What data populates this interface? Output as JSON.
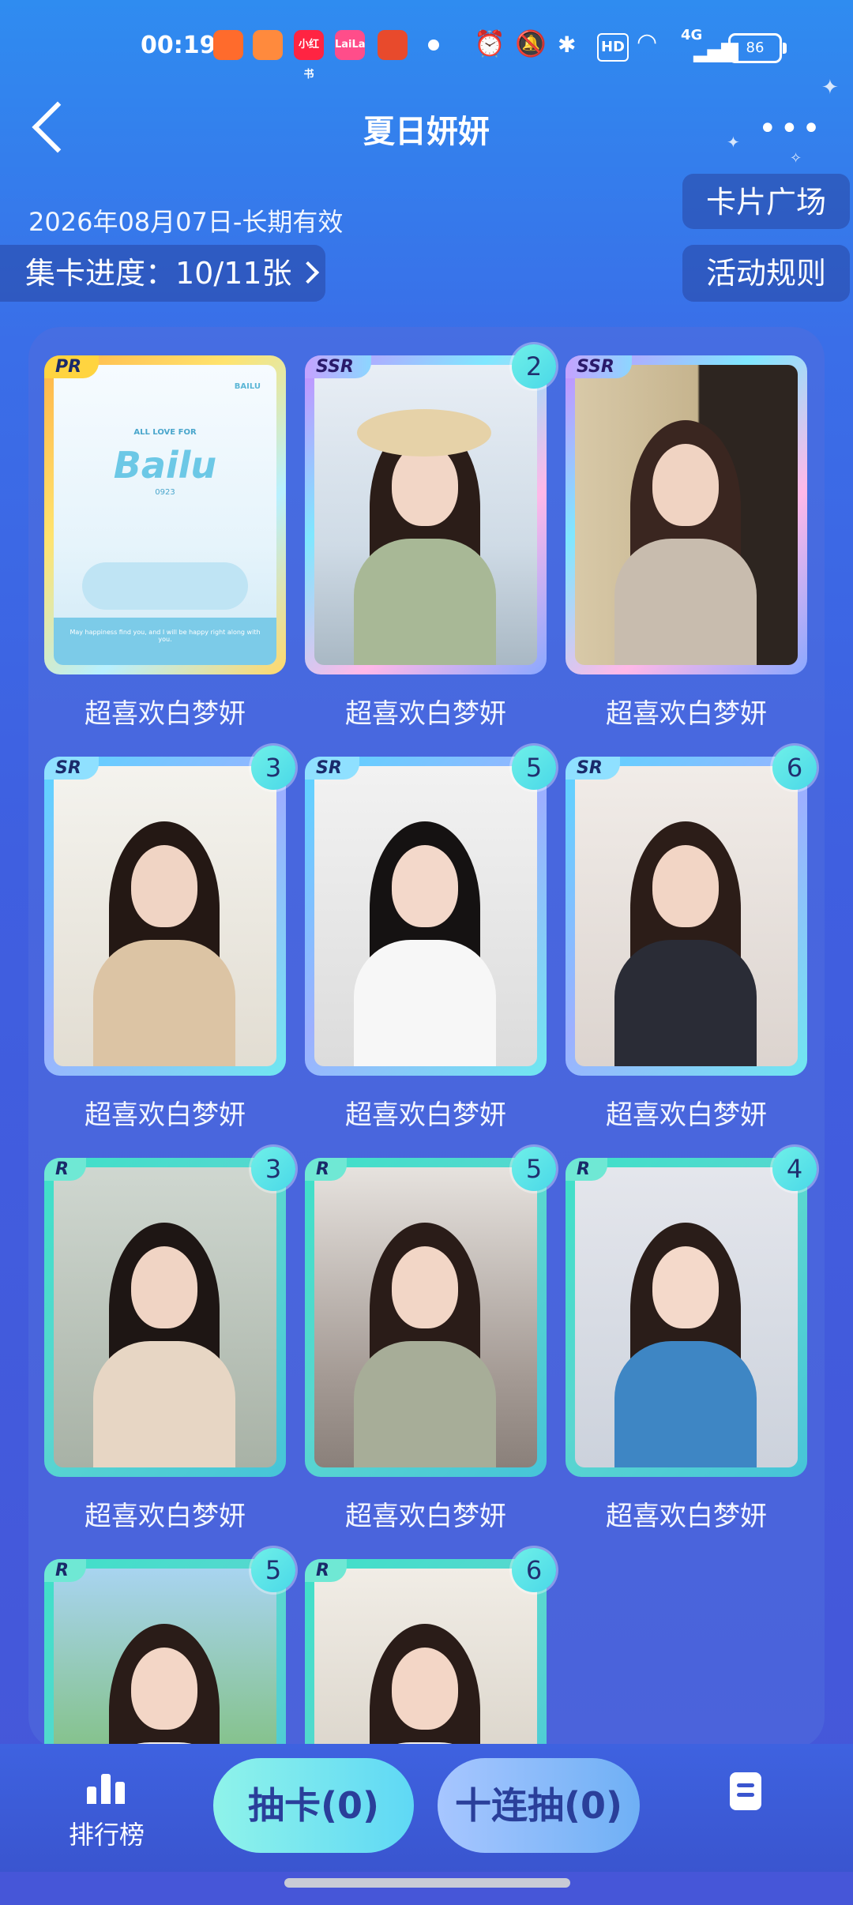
{
  "status_bar": {
    "time": "00:19",
    "apps": [
      {
        "icon": "kuaishou-icon",
        "label": "",
        "color": "#ff6b2c"
      },
      {
        "icon": "heart-app-icon",
        "label": "",
        "color": "#ff8a3d"
      },
      {
        "icon": "xiaohongshu-icon",
        "label": "小红书",
        "color": "#ff2442"
      },
      {
        "icon": "laila-icon",
        "label": "LaiLa",
        "color": "#ff4d8a"
      },
      {
        "icon": "shop-icon",
        "label": "",
        "color": "#e84a2c"
      }
    ],
    "hd": "HD",
    "network": "4G",
    "battery": "86"
  },
  "header": {
    "title": "夏日妍妍"
  },
  "validity": "2026年08月07日-长期有效",
  "progress_label": "集卡进度：10/11张",
  "plaza_button": "卡片广场",
  "rules_button": "活动规则",
  "cards": [
    {
      "rarity": "PR",
      "name": "超喜欢白梦妍",
      "count": "",
      "frame": "pr"
    },
    {
      "rarity": "SSR",
      "name": "超喜欢白梦妍",
      "count": "2",
      "frame": "ssr"
    },
    {
      "rarity": "SSR",
      "name": "超喜欢白梦妍",
      "count": "",
      "frame": "ssr"
    },
    {
      "rarity": "SR",
      "name": "超喜欢白梦妍",
      "count": "3",
      "frame": "sr"
    },
    {
      "rarity": "SR",
      "name": "超喜欢白梦妍",
      "count": "5",
      "frame": "sr"
    },
    {
      "rarity": "SR",
      "name": "超喜欢白梦妍",
      "count": "6",
      "frame": "sr"
    },
    {
      "rarity": "R",
      "name": "超喜欢白梦妍",
      "count": "3",
      "frame": "r"
    },
    {
      "rarity": "R",
      "name": "超喜欢白梦妍",
      "count": "5",
      "frame": "r"
    },
    {
      "rarity": "R",
      "name": "超喜欢白梦妍",
      "count": "4",
      "frame": "r"
    },
    {
      "rarity": "R",
      "name": "",
      "count": "5",
      "frame": "r"
    },
    {
      "rarity": "R",
      "name": "",
      "count": "6",
      "frame": "r"
    }
  ],
  "pr_card_art": {
    "top_left": "PR",
    "top_right": "BAILU",
    "tagline": "ALL LOVE FOR",
    "logo": "Bailu",
    "sub": "0923",
    "footer": "May happiness find you, and I will be happy right along with you."
  },
  "bottom_nav": {
    "rank_label": "排行榜",
    "draw_one": "抽卡(0)",
    "draw_ten": "十连抽(0)",
    "ticker": ""
  },
  "colors": {
    "bg_top": "#2f8cf0",
    "bg_bottom": "#4656d8",
    "accent_teal": "#6ff0e8"
  }
}
